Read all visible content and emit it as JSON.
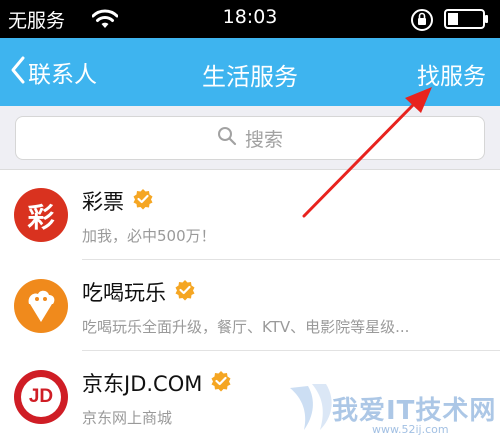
{
  "status_bar": {
    "carrier": "无服务",
    "time": "18:03"
  },
  "nav": {
    "back_label": "联系人",
    "title": "生活服务",
    "action_label": "找服务"
  },
  "search": {
    "placeholder": "搜索"
  },
  "services": [
    {
      "name": "彩票",
      "desc": "加我，必中500万！",
      "avatar_text": "彩",
      "avatar_color": "#d9321f",
      "verified": true
    },
    {
      "name": "吃喝玩乐",
      "desc": "吃喝玩乐全面升级，餐厅、KTV、电影院等星级...",
      "avatar_color": "#f08a1c",
      "verified": true
    },
    {
      "name": "京东JD.COM",
      "desc": "京东网上商城",
      "avatar_text": "JD",
      "avatar_color": "#cf1d25",
      "verified": true
    }
  ],
  "watermark": {
    "text": "我爱IT技术网",
    "url": "www.52ij.com"
  },
  "colors": {
    "nav_bg": "#3eb4ef",
    "verify_badge": "#f5a623",
    "annotation_arrow": "#e8231e"
  }
}
